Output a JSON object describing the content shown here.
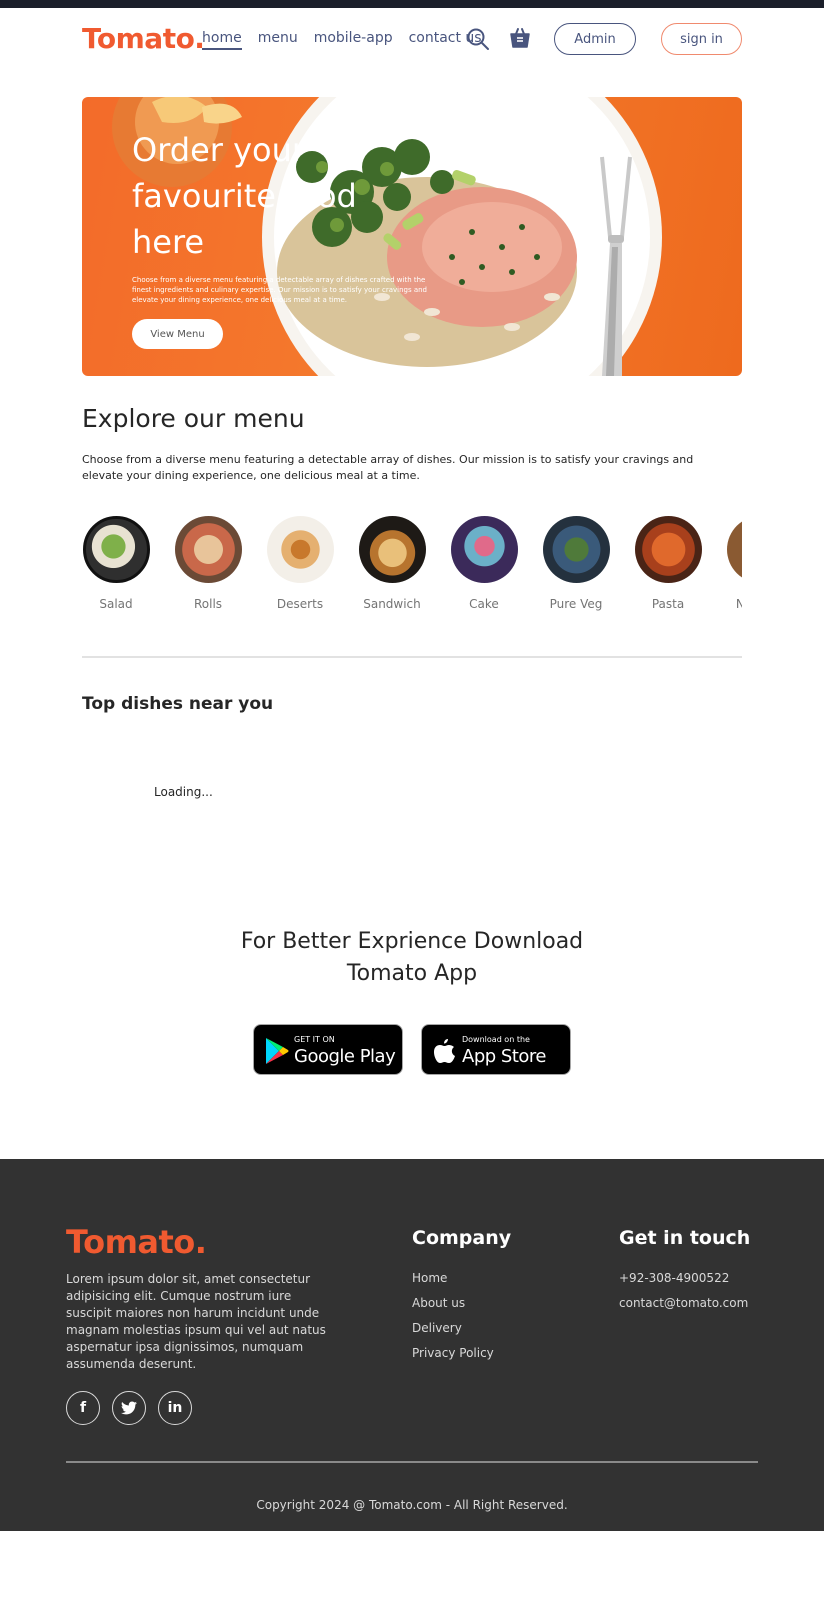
{
  "navbar": {
    "logo": "Tomato.",
    "links": [
      "home",
      "menu",
      "mobile-app",
      "contact us"
    ],
    "admin_label": "Admin",
    "signin_label": "sign in",
    "icons": [
      "search-icon",
      "basket-icon"
    ]
  },
  "hero": {
    "title": "Order your favourite food here",
    "description": "Choose from a diverse menu featuring a detectable array of dishes crafted with the finest ingredients and culinary expertise. Our mission is to satisfy your cravings and elevate your dining experience, one delicious meal at a time.",
    "button_label": "View Menu"
  },
  "explore": {
    "title": "Explore our menu",
    "description": "Choose from a diverse menu featuring a detectable array of dishes. Our mission is to satisfy your cravings and elevate your dining experience, one delicious meal at a time.",
    "items": [
      "Salad",
      "Rolls",
      "Deserts",
      "Sandwich",
      "Cake",
      "Pure Veg",
      "Pasta",
      "Noodles"
    ]
  },
  "top_dishes": {
    "title": "Top dishes near you",
    "loading": "Loading..."
  },
  "app_download": {
    "title": "For Better Exprience Download Tomato App",
    "google_small": "GET IT ON",
    "google_big": "Google Play",
    "apple_small": "Download on the",
    "apple_big": "App Store"
  },
  "footer": {
    "logo": "Tomato.",
    "description": "Lorem ipsum dolor sit, amet consectetur adipisicing elit. Cumque nostrum iure suscipit maiores non harum incidunt unde magnam molestias ipsum qui vel aut natus aspernatur ipsa dignissimos, numquam assumenda deserunt.",
    "socials": [
      "f",
      "t",
      "in"
    ],
    "company_title": "Company",
    "company_links": [
      "Home",
      "About us",
      "Delivery",
      "Privacy Policy"
    ],
    "touch_title": "Get in touch",
    "phone": "+92-308-4900522",
    "email": "contact@tomato.com",
    "copyright": "Copyright 2024 @ Tomato.com - All Right Reserved."
  },
  "colors": {
    "brand": "#f05a30",
    "nav_text": "#49557e",
    "footer_bg": "#323232"
  }
}
